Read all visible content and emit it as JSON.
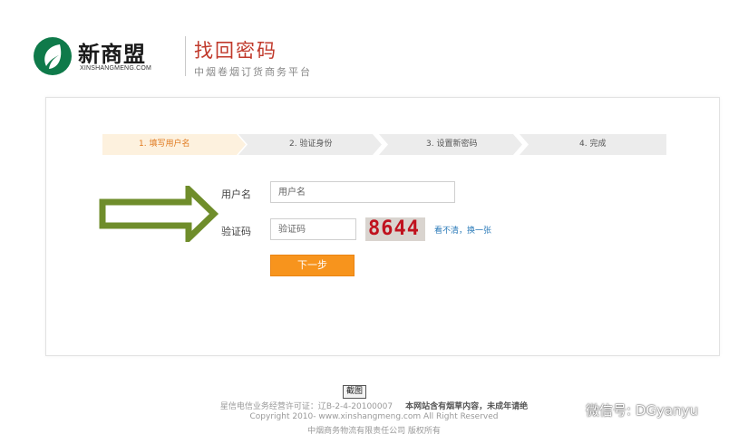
{
  "header": {
    "logo_text": "新商盟",
    "logo_sub": "XINSHANGMENG.COM",
    "title": "找回密码",
    "subtitle": "中烟卷烟订货商务平台"
  },
  "steps": [
    {
      "label": "1. 填写用户名",
      "active": true
    },
    {
      "label": "2. 验证身份",
      "active": false
    },
    {
      "label": "3. 设置新密码",
      "active": false
    },
    {
      "label": "4. 完成",
      "active": false
    }
  ],
  "form": {
    "username_label": "用户名",
    "username_placeholder": "用户名",
    "captcha_label": "验证码",
    "captcha_placeholder": "验证码",
    "captcha_value": "8644",
    "refresh_link": "看不清，换一张",
    "next_button": "下一步"
  },
  "footer": {
    "screenshot_tag": "截图",
    "license": "星信电信业务经营许可证：辽B-2-4-20100007",
    "notice": "本网站含有烟草内容，未成年请绝",
    "copyright": "Copyright 2010- www.xinshangmeng.com All Right Reserved",
    "company": "中烟商务物流有限责任公司 版权所有"
  },
  "watermark": {
    "text": "微信号: DGyanyu"
  },
  "colors": {
    "accent": "#f7941d",
    "title_red": "#c0392b",
    "logo_green": "#0f7a4a",
    "arrow_green": "#6f8d2b"
  }
}
